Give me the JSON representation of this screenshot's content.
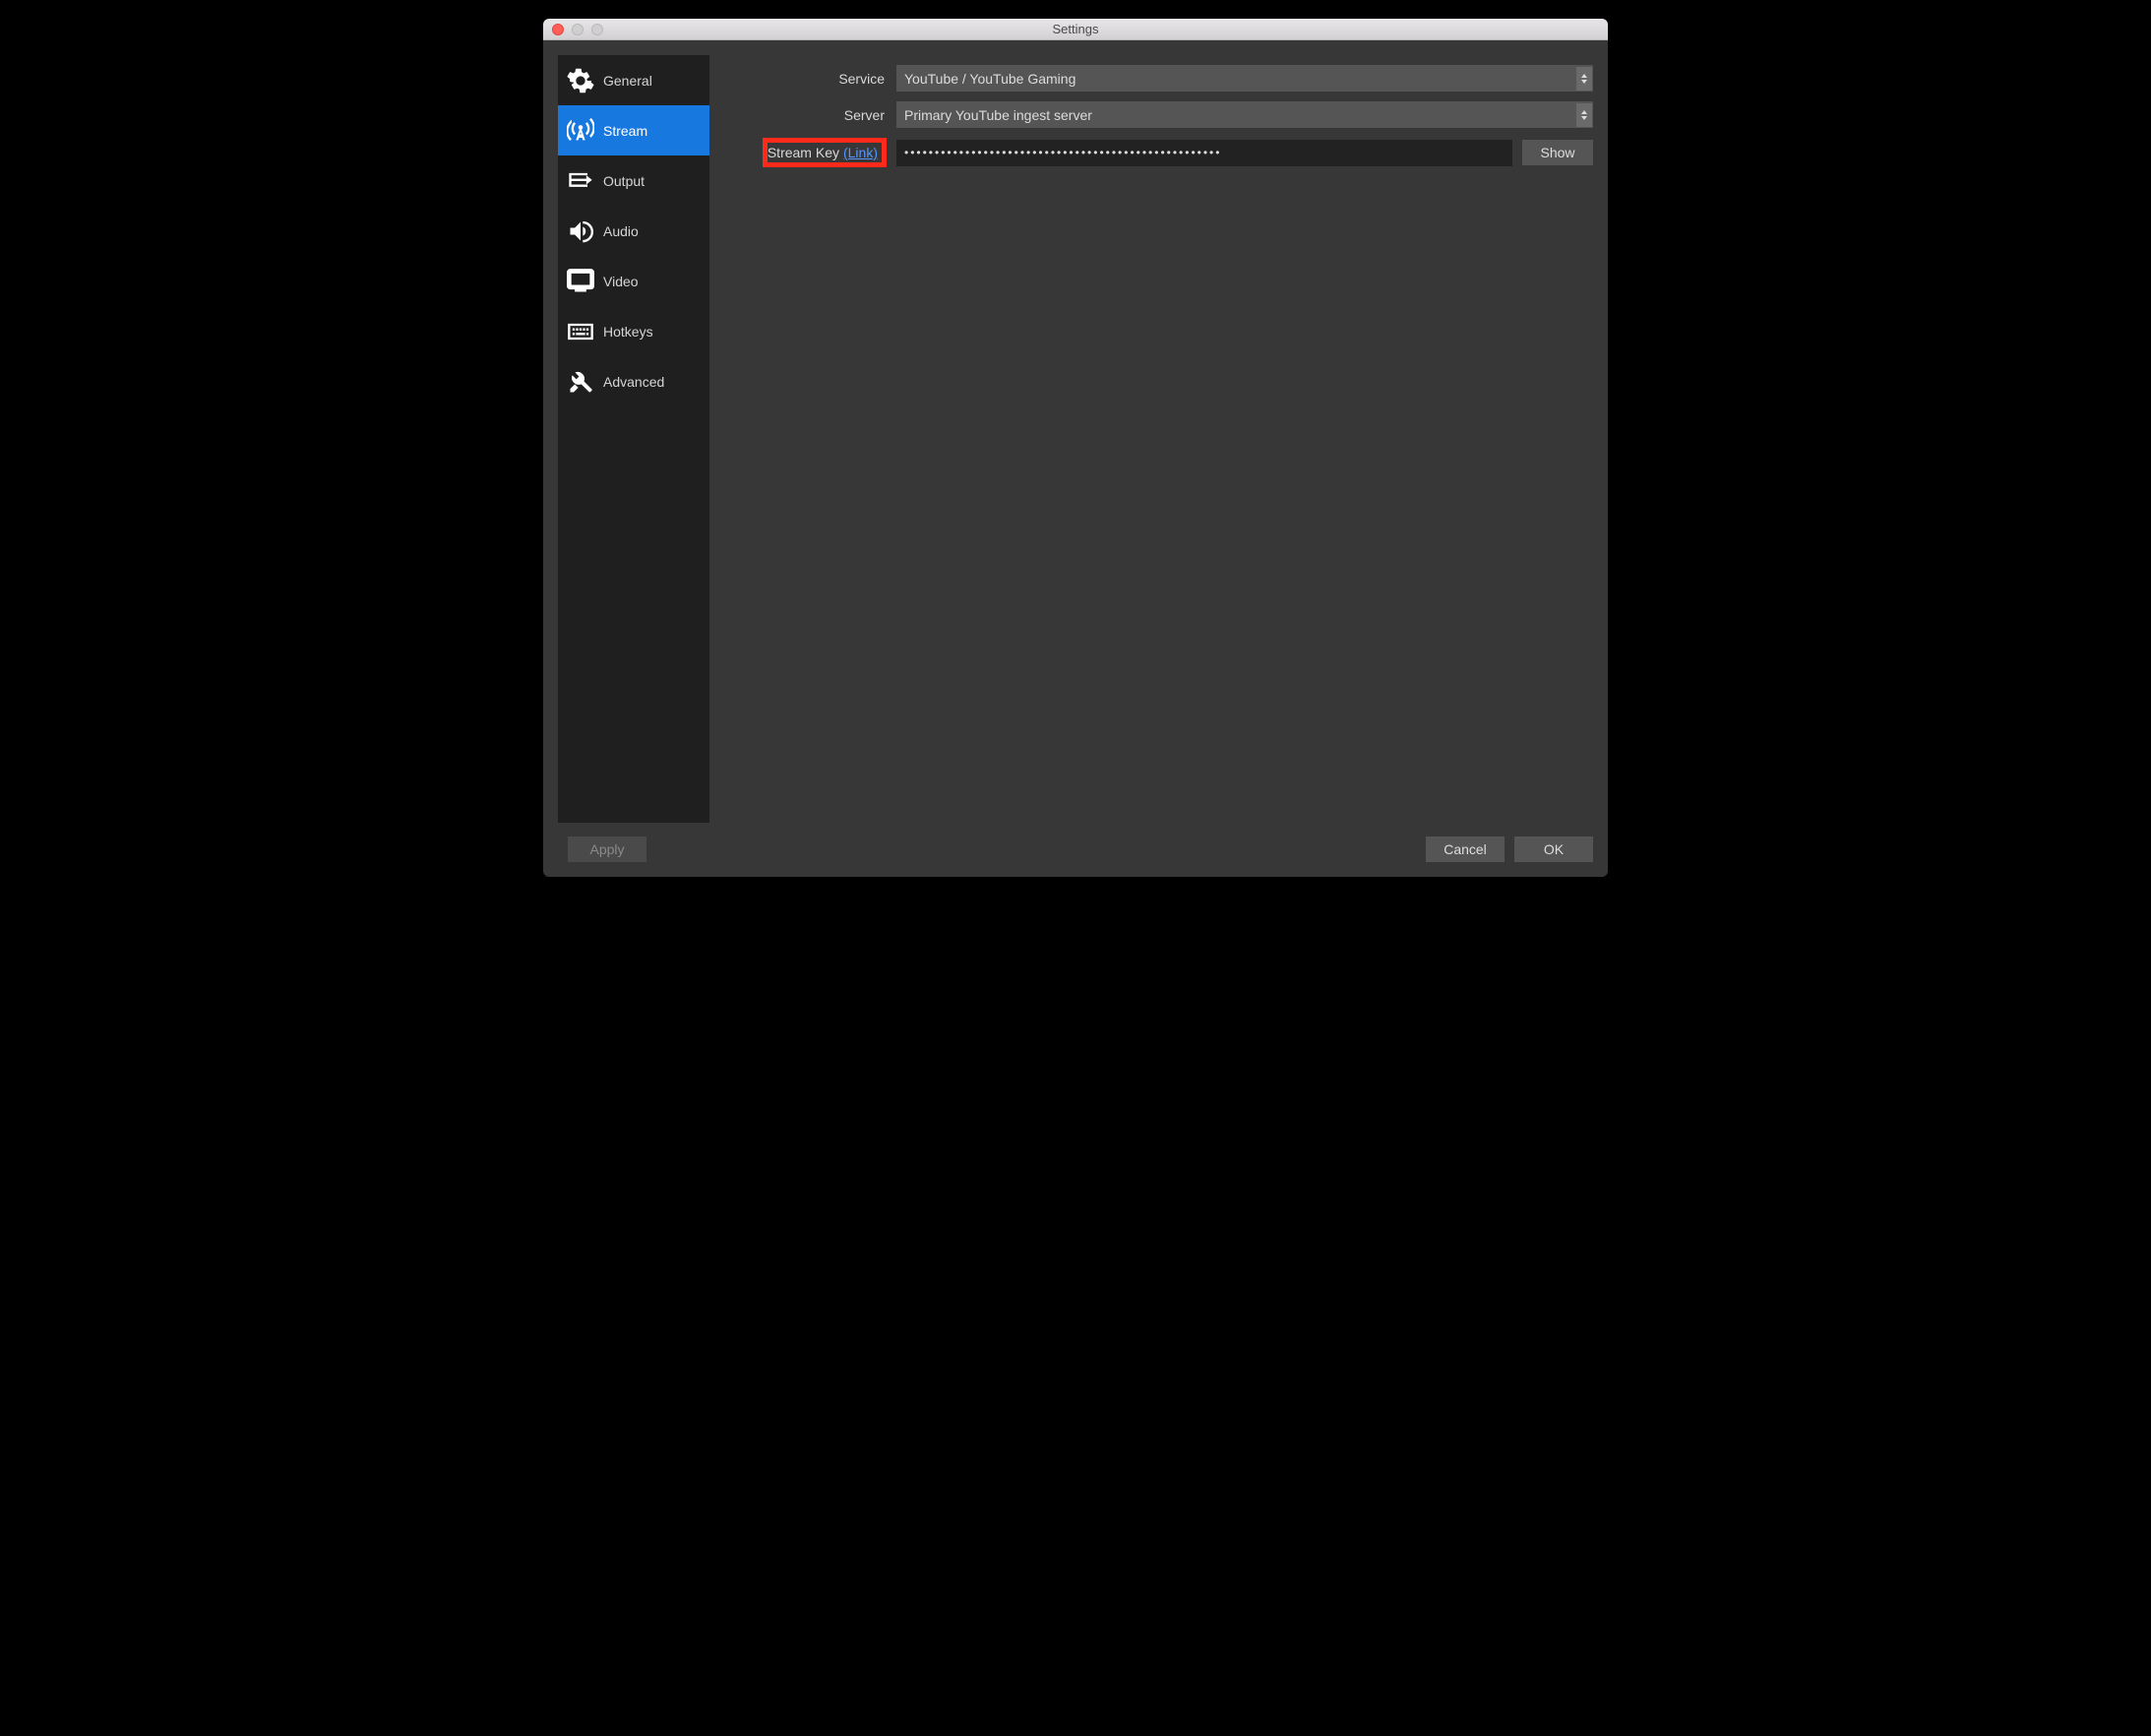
{
  "window": {
    "title": "Settings"
  },
  "sidebar": {
    "items": [
      {
        "id": "general",
        "label": "General",
        "selected": false
      },
      {
        "id": "stream",
        "label": "Stream",
        "selected": true
      },
      {
        "id": "output",
        "label": "Output",
        "selected": false
      },
      {
        "id": "audio",
        "label": "Audio",
        "selected": false
      },
      {
        "id": "video",
        "label": "Video",
        "selected": false
      },
      {
        "id": "hotkeys",
        "label": "Hotkeys",
        "selected": false
      },
      {
        "id": "advanced",
        "label": "Advanced",
        "selected": false
      }
    ]
  },
  "form": {
    "service_label": "Service",
    "service_value": "YouTube / YouTube Gaming",
    "server_label": "Server",
    "server_value": "Primary YouTube ingest server",
    "streamkey_label": "Stream Key",
    "streamkey_link": "(Link)",
    "streamkey_value": "••••••••••••••••••••••••••••••••••••••••••••••••••••",
    "show_button": "Show"
  },
  "footer": {
    "apply": "Apply",
    "cancel": "Cancel",
    "ok": "OK"
  }
}
